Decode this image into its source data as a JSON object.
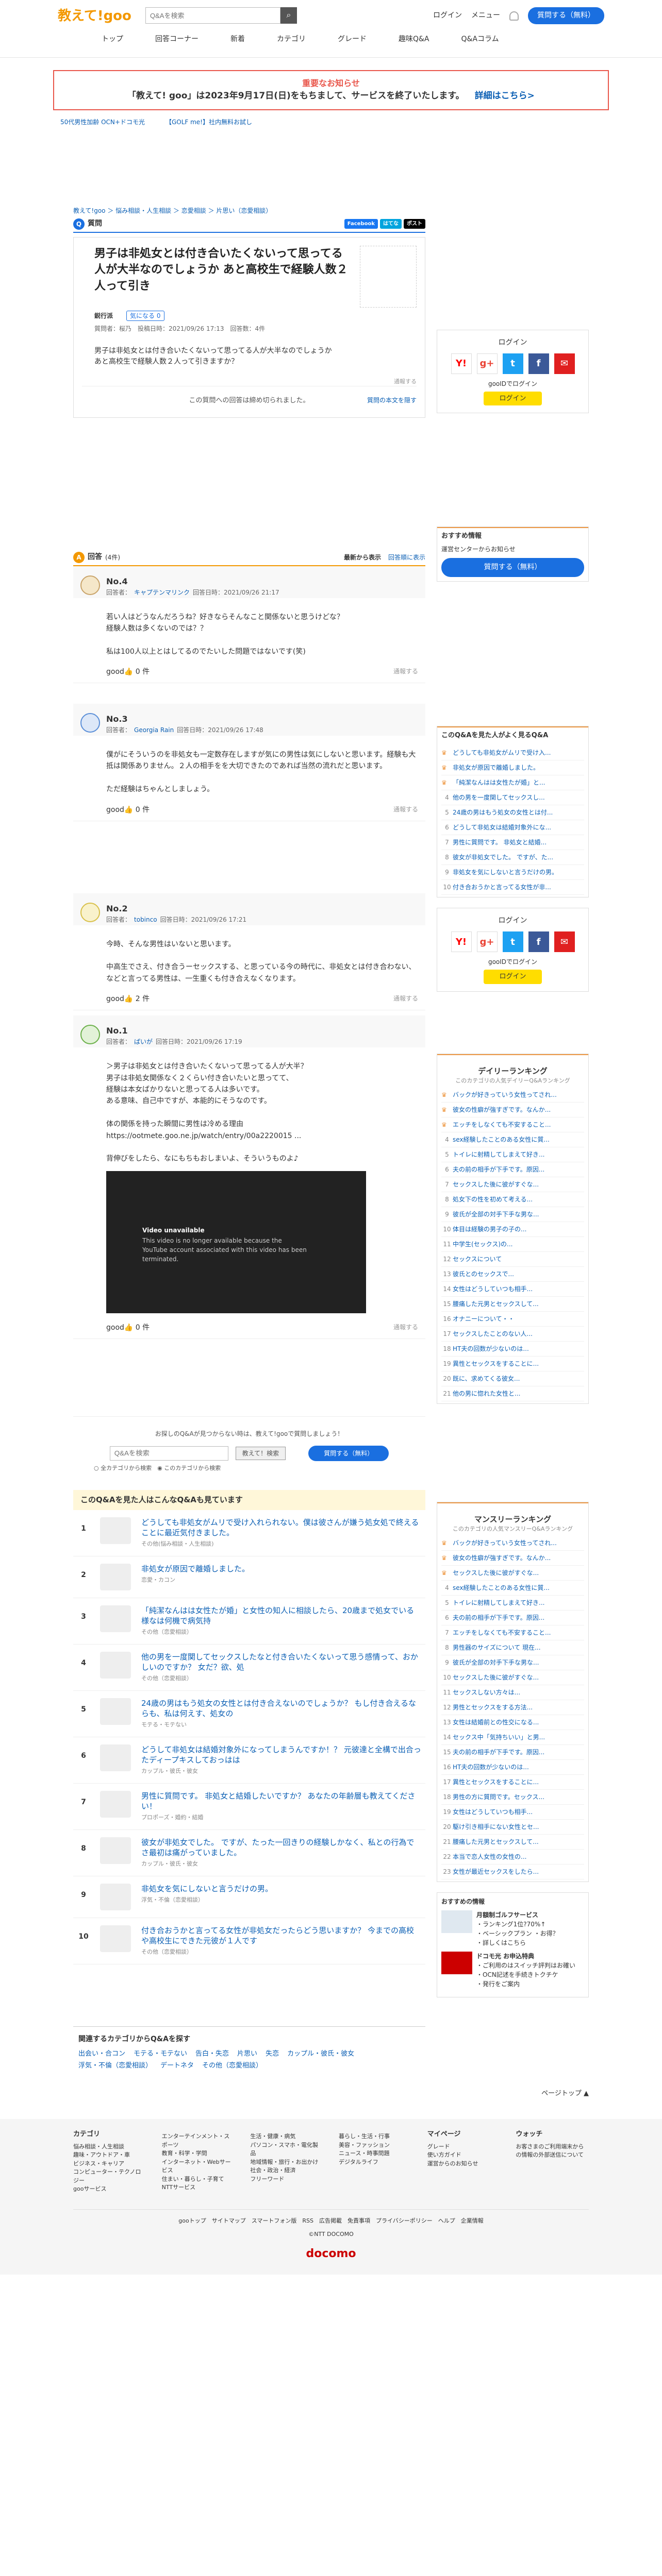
{
  "header": {
    "logo_main": "教えて!",
    "logo_goo": "goo",
    "search_placeholder": "Q&Aを検索",
    "login": "ログイン",
    "menu": "メニュー",
    "ask": "質問する（無料）"
  },
  "nav": [
    "トップ",
    "回答コーナー",
    "新着",
    "カテゴリ",
    "グレード",
    "趣味Q&A",
    "Q&Aコラム"
  ],
  "notice": {
    "title": "重要なお知らせ",
    "text": "「教えて! goo」は2023年9月17日(日)をもちまして、サービスを終了いたします。",
    "link": "詳細はこちら>"
  },
  "promo": [
    "50代男性加齢 OCN+ドコモ光",
    "【GOLF me!】社内無料お試し"
  ],
  "breadcrumb": "教えて!goo ＞ 悩み相談・人生相談 ＞ 恋愛相談 ＞ 片思い（恋愛相談）",
  "question": {
    "label": "質問",
    "title": "男子は非処女とは付き合いたくないって思ってる人が大半なのでしょうか あと高校生で経験人数２人って引き",
    "author": "鋭行派",
    "kininaru": "気になる",
    "count": "0",
    "meta": "質問者：桜乃　投稿日時：2021/09/26 17:13　回答数：4件",
    "body": "男子は非処女とは付き合いたくないって思ってる人が大半なのでしょうか\nあと高校生で経験人数２人って引きますか？",
    "report": "通報する",
    "closed": "この質問への回答は締め切られました。",
    "addlink": "質問の本文を隠す",
    "share": [
      "Facebook",
      "はてな",
      "ポスト"
    ]
  },
  "answers_header": {
    "label": "回答",
    "count": "(4件)",
    "sort1": "最新から表示",
    "sort2": "回答順に表示"
  },
  "answers": [
    {
      "no": "No.4",
      "author": "キャプテンマリンク",
      "date": "回答日時：2021/09/26 21:17",
      "body": "若い人はどうなんだろうね？好きならそんなこと関係ないと思うけどな？\n経験人数は多くないのでは？？\n\n私は100人以上とはしてるのでたいした問題ではないです(笑)",
      "good": "0 件",
      "report": "通報する"
    },
    {
      "no": "No.3",
      "author": "Georgia Rain",
      "date": "回答日時：2021/09/26 17:48",
      "body": "僕がにそういうのを非処女も一定数存在しますが気にの男性は気にしないと思います。経験も大抵は関係ありません。２人の相手をを大切できたのであれば当然の流れだと思います。\n\nただ経験はちゃんとしましょう。",
      "good": "0 件",
      "report": "通報する"
    },
    {
      "no": "No.2",
      "author": "tobinco",
      "date": "回答日時：2021/09/26 17:21",
      "body": "今時、そんな男性はいないと思います。\n\n中高生でさえ、付き合うーセックスする、と思っている今の時代に、非処女とは付き合わない、などと言ってる男性は、一生重くも付き合えなくなります。",
      "good": "2 件",
      "report": "通報する"
    },
    {
      "no": "No.1",
      "author": "ぱいが",
      "date": "回答日時：2021/09/26 17:19",
      "body": "＞男子は非処女とは付き合いたくないって思ってる人が大半？\n男子は非処女関係なく２くらい付き合いたいと思ってて、\n経験は本女ばかりないと思ってる人は多いです。\nある意味、自己中ですが、本能的にそうなのです。\n\n体の関係を持った瞬間に男性は冷める理由\nhttps://ootmete.goo.ne.jp/watch/entry/00a2220015 ...\n\n背伸びをしたら、なにもちもおしまいよ、そういうものよ♪",
      "video_t1": "Video unavailable",
      "video_t2": "This video is no longer available because the YouTube account associated with this video has been terminated.",
      "good": "0 件",
      "report": "通報する"
    }
  ],
  "askbox": {
    "text": "お探しのQ&Aが見つからない時は、教えて!gooで質問しましょう！",
    "placeholder": "Q&Aを検索",
    "search_btn": "教えて！検索",
    "ask_btn": "質問する（無料）",
    "opt1": "全カテゴリから検索",
    "opt2": "このカテゴリから検索"
  },
  "related": {
    "title": "このQ&Aを見た人はこんなQ&Aも見ています",
    "items": [
      {
        "rank": "1",
        "title": "どうしても非処女がムリで受け入れられない。僕は彼さんが嫌う処女処で終えることに最近気付きました。",
        "cat": "その他(悩み相談・人生相談)"
      },
      {
        "rank": "2",
        "title": "非処女が原因で離婚しました。",
        "cat": "恋愛・カコン"
      },
      {
        "rank": "3",
        "title": "「純潔なんはは女性たが婚」と女性の知人に相談したら、20歳まで処女でいる様なは何機で病気持",
        "cat": "その他（恋愛相談）"
      },
      {
        "rank": "4",
        "title": "他の男を一度関してセックスしたなと付き合いたくないって思う感情って、おかしいのですか？ 女だ？欲、処",
        "cat": "その他（恋愛相談）"
      },
      {
        "rank": "5",
        "title": "24歳の男はもう処女の女性とは付き合えないのでしょうか？ もし付き合えるならも、私は何えす、処女の",
        "cat": "モテる・モテない"
      },
      {
        "rank": "6",
        "title": "どうして非処女は結婚対象外になってしまうんですか！？ 元彼達と全構で出合ったディープキスしておっはは",
        "cat": "カップル・彼氏・彼女"
      },
      {
        "rank": "7",
        "title": "男性に質問です。 非処女と結婚したいですか？ あなたの年齢層も教えてください！",
        "cat": "プロポーズ・婚約・結婚"
      },
      {
        "rank": "8",
        "title": "彼女が非処女でした。 ですが、たった一回きりの経験しかなく、私との行為でさ最初は痛がっていました。",
        "cat": "カップル・彼氏・彼女"
      },
      {
        "rank": "9",
        "title": "非処女を気にしないと言うだけの男。",
        "cat": "浮気・不倫（恋愛相談）"
      },
      {
        "rank": "10",
        "title": "付き合おうかと言ってる女性が非処女だったらどう思いますか？ 今までの高校や高校生にできた元彼が１人です",
        "cat": "その他（恋愛相談）"
      }
    ]
  },
  "categories": {
    "title": "関連するカテゴリからQ&Aを探す",
    "items": [
      "出会い・合コン",
      "モテる・モテない",
      "告白・失恋",
      "片思い",
      "失恋",
      "カップル・彼氏・彼女",
      "浮気・不倫（恋愛相談）",
      "デートネタ",
      "その他（恋愛相談）"
    ]
  },
  "side": {
    "login_title": "ログイン",
    "gooid": "gooIDでログイン",
    "login_btn": "ログイン",
    "recommend_title": "おすすめ情報",
    "recommend_link": "運営センターからお知らせ",
    "ask_btn": "質問する（無料）",
    "also_title": "このQ&Aを見た人がよく見るQ&A",
    "also": [
      "どうしても非処女がムリで受け入...",
      "非処女が原因で離婚しました。",
      "「純潔なんはは女性たが婚」と...",
      "他の男を一度関してセックスし...",
      "24歳の男はもう処女の女性とは付...",
      "どうして非処女は結婚対象外にな...",
      "男性に質問です。 非処女と結婚...",
      "彼女が非処女でした。 ですが、た...",
      "非処女を気にしないと言うだけの男。",
      "付き合おうかと言ってる女性が非..."
    ],
    "daily_title": "デイリーランキング",
    "daily_sub": "このカテゴリの人気デイリーQ&Aランキング",
    "daily": [
      "バックが好きっていう女性ってされ...",
      "彼女の性癖が強すぎです。なんか...",
      "エッチをしなくても不安すること...",
      "sex経験したことのある女性に質...",
      "トイレに射精してしまえて好き...",
      "夫の前の相手が下手です。原因...",
      "セックスした後に彼がすぐな...",
      "処女下の性を初めて考える...",
      "彼氏が全部の対手下手な男な...",
      "体目は経験の男子の子の...",
      "中学生(セックス)の...",
      "セックスについて",
      "彼氏とのセックスで...",
      "女性はどうしていつも相手...",
      "腰痛した元男とセックスして...",
      "オナニーについて・・",
      "セックスしたことのない人...",
      "HT夫の回数が少ないのは...",
      "異性とセックスをすることに...",
      "既に、求めてくる彼女...",
      "他の男に惚れた女性と..."
    ],
    "monthly_title": "マンスリーランキング",
    "monthly_sub": "このカテゴリの人気マンスリーQ&Aランキング",
    "monthly": [
      "バックが好きっていう女性ってされ...",
      "彼女の性癖が強すぎです。なんか...",
      "セックスした後に彼がすぐな...",
      "sex経験したことのある女性に質...",
      "トイレに射精してしまえて好き...",
      "夫の前の相手が下手です。原因...",
      "エッチをしなくても不安すること...",
      "男性器のサイズについて 現在...",
      "彼氏が全部の対手下手な男な...",
      "セックスした後に彼がすぐな...",
      "セックスしない方々は...",
      "男性とセックスをする方法...",
      "女性は結婚前との性交になる...",
      "セックス中「気持ちいい」と男...",
      "夫の前の相手が下手です。原因...",
      "HT夫の回数が少ないのは...",
      "異性とセックスをすることに...",
      "男性の方に質問です。セックス...",
      "女性はどうしていつも相手...",
      "駆け引き相手にない女性とセ...",
      "腰痛した元男とセックスして...",
      "本当で恋人女性の女性の...",
      "女性が最近セックスをしたら..."
    ],
    "goodpr_title": "おすすめの情報",
    "goodpr": [
      {
        "title": "月額制ゴルフサービス",
        "sub": "・ランキング1位?70%↑\n・ベーシックプラン ・お得？",
        "foot": "・詳しくはこちら"
      },
      {
        "title": "ドコモ光 お申込特典",
        "sub": "・ご利用のはスイッチ評判はお確い\n・OCN記述を手続きトクチケ",
        "foot": "・発行をご案内"
      }
    ]
  },
  "footer": {
    "cols": [
      {
        "h": "カテゴリ",
        "items": [
          "悩み相談・人生相談",
          "趣味・アウトドア・車",
          "ビジネス・キャリア",
          "コンピューター・テクノロジー",
          "gooサービス"
        ]
      },
      {
        "h": "",
        "items": [
          "エンターテインメント・スポーツ",
          "教育・科学・学問",
          "インターネット・Webサービス",
          "住まい・暮らし・子育て",
          "NTTサービス"
        ]
      },
      {
        "h": "",
        "items": [
          "生活・健康・病気",
          "パソコン・スマホ・電化製品",
          "地域情報・旅行・お出かけ",
          "社会・政治・経済",
          "フリーワード"
        ]
      },
      {
        "h": "",
        "items": [
          "暮らし・生活・行事",
          "美容・ファッション",
          "ニュース・時事問題",
          "デジタルライフ"
        ]
      },
      {
        "h": "マイページ",
        "items": [
          "グレード",
          "使い方ガイド",
          "運営からのお知らせ"
        ]
      },
      {
        "h": "ウォッチ",
        "items": [
          "お客さまのご利用端末からの情報の外部送信について"
        ]
      }
    ],
    "links": "gooトップ　サイトマップ　スマートフォン版　RSS　広告掲載　免責事項　プライバシーポリシー　ヘルプ　企業情報",
    "copy": "©NTT DOCOMO",
    "brand": "docomo",
    "pagetop": "ページトップ"
  }
}
